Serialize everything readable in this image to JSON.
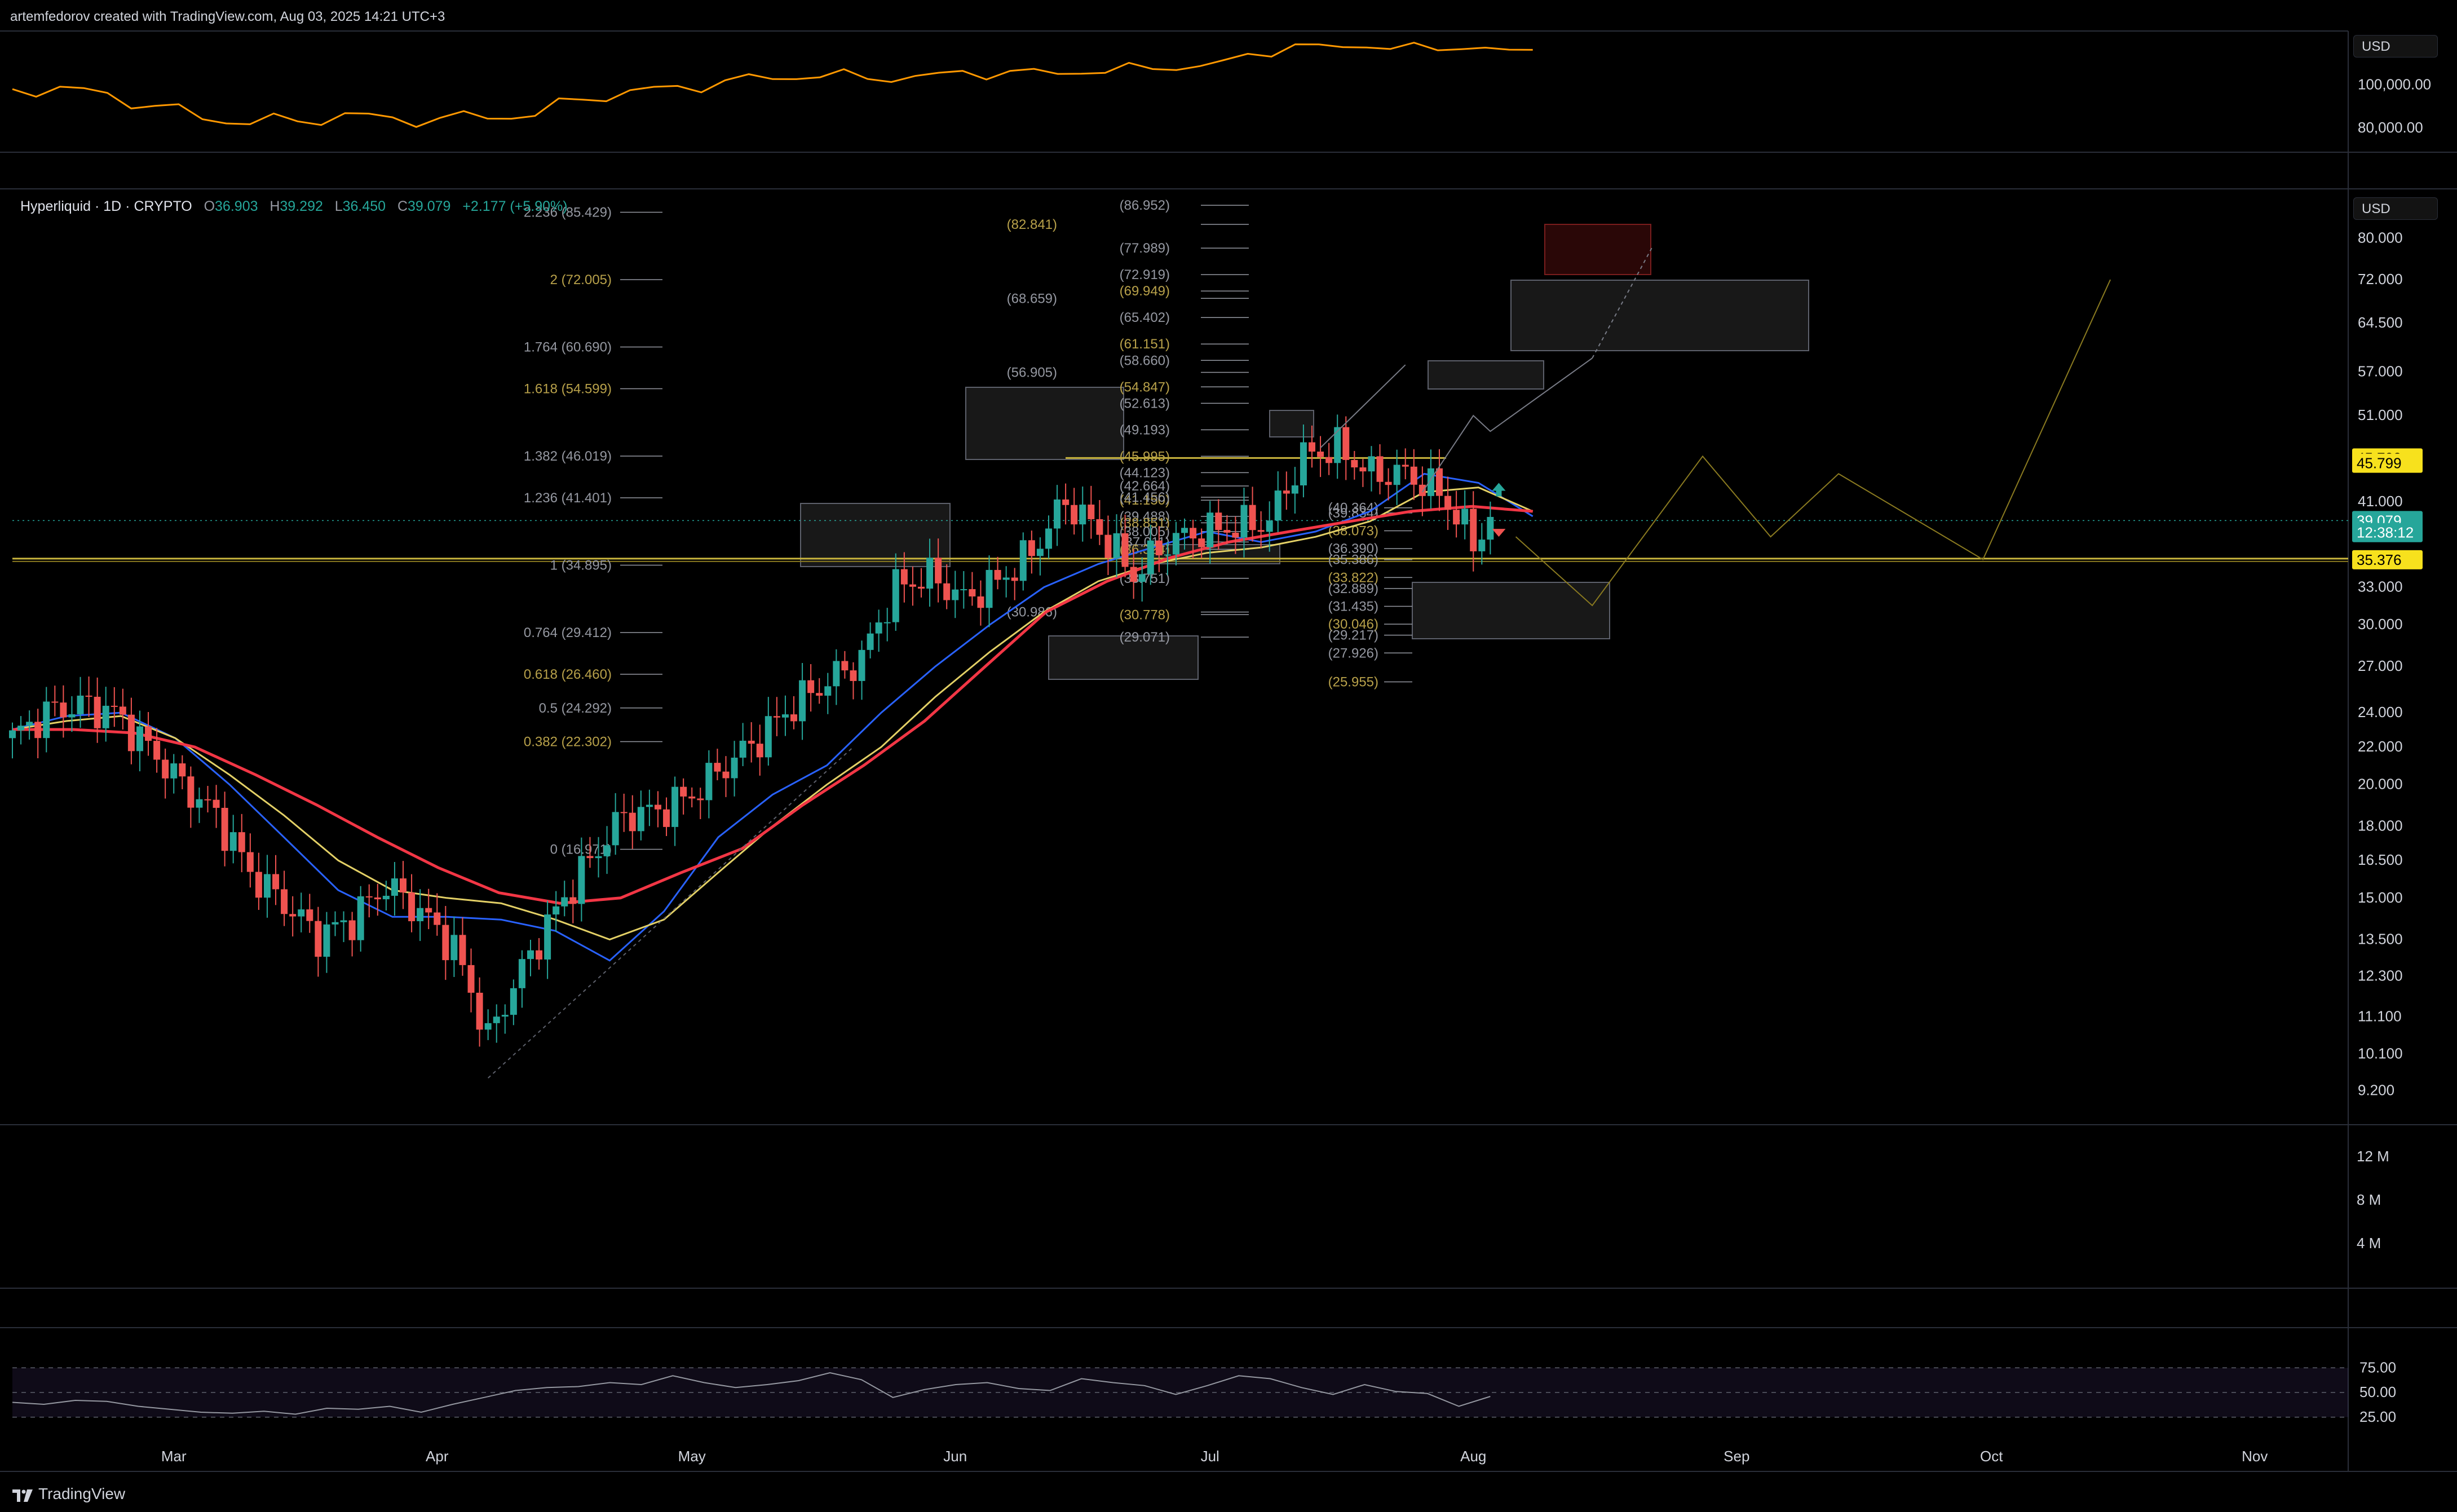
{
  "header": {
    "title": "artemfedorov created with TradingView.com, Aug 03, 2025 14:21 UTC+3",
    "brand": "TradingView"
  },
  "symbol": {
    "name": "Hyperliquid · 1D · CRYPTO",
    "o_label": "O",
    "o": "36.903",
    "h_label": "H",
    "h": "39.292",
    "l_label": "L",
    "l": "36.450",
    "c_label": "C",
    "c": "39.079",
    "change": "+2.177 (+5.90%)"
  },
  "currency": "USD",
  "colors": {
    "background": "#000000",
    "up": "#26a69a",
    "down": "#ef5350",
    "ema_blue": "#2962ff",
    "ema_yellow": "#e3d066",
    "ema_red": "#f23645",
    "btc_line": "#ff9800",
    "fib": "#9c8b3a",
    "rsi_band": "#7e57c2"
  },
  "chart_data": [
    {
      "type": "line",
      "pane": "top",
      "series": [
        {
          "values": [
            98000,
            97000,
            94000,
            90000,
            86000,
            84000,
            83500,
            85000,
            82500,
            84000,
            86000,
            88000,
            94000,
            96000,
            97000,
            101000,
            104000,
            106000,
            104000,
            103000,
            104000,
            105000,
            106000,
            108000,
            109000,
            108000,
            112000,
            117000,
            118000,
            119000,
            118000,
            117000,
            114000
          ]
        }
      ],
      "x_range": [
        "2025-02-10",
        "2025-08-03"
      ],
      "y_ticks": [
        "100,000.00",
        "80,000.00"
      ],
      "ylim": [
        70000,
        125000
      ]
    },
    {
      "type": "candlestick",
      "pane": "main",
      "scale": "log",
      "ylim": [
        8.5,
        90
      ],
      "y_ticks": [
        "80.000",
        "72.000",
        "64.500",
        "57.000",
        "51.000",
        "45.799",
        "41.000",
        "33.000",
        "30.000",
        "27.000",
        "24.000",
        "22.000",
        "20.000",
        "18.000",
        "16.500",
        "15.000",
        "13.500",
        "12.300",
        "11.100",
        "10.100",
        "9.200"
      ],
      "price_labels": [
        {
          "text": "45.799",
          "value": 45.799,
          "color": "#f7e11d"
        },
        {
          "text": "45.799",
          "value": 45.2,
          "color": "#f7e11d"
        },
        {
          "text": "39.079",
          "value": 39.079,
          "color": "#26a69a"
        },
        {
          "text": "12:38:12",
          "value": 37.9,
          "color": "#26a69a"
        },
        {
          "text": "35.376",
          "value": 35.376,
          "color": "#f7e11d"
        }
      ],
      "close_path": [
        [
          "2025-02-10",
          22.5
        ],
        [
          "2025-02-14",
          24
        ],
        [
          "2025-02-18",
          24.5
        ],
        [
          "2025-02-22",
          24
        ],
        [
          "2025-02-26",
          22
        ],
        [
          "2025-03-02",
          20
        ],
        [
          "2025-03-06",
          18.5
        ],
        [
          "2025-03-10",
          16
        ],
        [
          "2025-03-14",
          14.8
        ],
        [
          "2025-03-18",
          13.6
        ],
        [
          "2025-03-22",
          14.2
        ],
        [
          "2025-03-26",
          15.5
        ],
        [
          "2025-03-30",
          14.5
        ],
        [
          "2025-04-03",
          13.2
        ],
        [
          "2025-04-07",
          10.5
        ],
        [
          "2025-04-11",
          12.5
        ],
        [
          "2025-04-15",
          14.5
        ],
        [
          "2025-04-19",
          16.5
        ],
        [
          "2025-04-23",
          18.5
        ],
        [
          "2025-04-27",
          18.7
        ],
        [
          "2025-05-01",
          19.5
        ],
        [
          "2025-05-05",
          21
        ],
        [
          "2025-05-09",
          22.5
        ],
        [
          "2025-05-13",
          24.5
        ],
        [
          "2025-05-17",
          26
        ],
        [
          "2025-05-21",
          27.5
        ],
        [
          "2025-05-25",
          33
        ],
        [
          "2025-05-29",
          34
        ],
        [
          "2025-06-02",
          32
        ],
        [
          "2025-06-06",
          33.5
        ],
        [
          "2025-06-10",
          36
        ],
        [
          "2025-06-14",
          41
        ],
        [
          "2025-06-18",
          38
        ],
        [
          "2025-06-22",
          34
        ],
        [
          "2025-06-26",
          37
        ],
        [
          "2025-06-30",
          38
        ],
        [
          "2025-07-04",
          38.5
        ],
        [
          "2025-07-08",
          39
        ],
        [
          "2025-07-12",
          46
        ],
        [
          "2025-07-16",
          47
        ],
        [
          "2025-07-20",
          44
        ],
        [
          "2025-07-24",
          44
        ],
        [
          "2025-07-28",
          42
        ],
        [
          "2025-08-01",
          37
        ],
        [
          "2025-08-03",
          39.079
        ]
      ],
      "moving_averages": [
        {
          "name": "",
          "color": "#2962ff",
          "values": [
            23,
            23.8,
            24,
            22.5,
            20,
            17.5,
            15.3,
            14.3,
            14.3,
            14.2,
            13.8,
            12.8,
            14.5,
            17.5,
            19.5,
            21,
            24,
            27,
            30,
            33,
            35,
            36.5,
            38,
            37,
            38,
            40,
            44,
            43,
            39.5
          ]
        },
        {
          "name": "",
          "color": "#e3d066",
          "values": [
            23,
            23.5,
            23.8,
            22.5,
            20.5,
            18.5,
            16.5,
            15.3,
            15,
            14.8,
            14.2,
            13.5,
            14.2,
            16,
            18,
            20,
            22,
            25,
            28,
            31,
            33.5,
            35,
            36,
            36.5,
            37.5,
            39,
            42,
            42.5,
            40
          ]
        },
        {
          "name": "",
          "color": "#f23645",
          "values": [
            23,
            23,
            22.8,
            22,
            20.5,
            19,
            17.5,
            16.2,
            15.2,
            14.8,
            15,
            16,
            17,
            19,
            21,
            23.5,
            27,
            31,
            33.5,
            35.5,
            37,
            38,
            39,
            40,
            40.5,
            40
          ]
        }
      ],
      "fib_left": [
        "2.236 (85.429)",
        "2 (72.005)",
        "1.764 (60.690)",
        "1.618 (54.599)",
        "1.382 (46.019)",
        "1.236 (41.401)",
        "1 (34.895)",
        "0.764 (29.412)",
        "0.618 (26.460)",
        "0.5 (24.292)",
        "0.382 (22.302)",
        "0 (16.971)"
      ],
      "fib_mid": [
        "(86.952)",
        "(82.841)",
        "(77.989)",
        "(72.919)",
        "(69.949)",
        "(68.659)",
        "(65.402)",
        "(61.151)",
        "(58.660)",
        "(56.905)",
        "(54.847)",
        "(52.613)",
        "(49.193)",
        "(45.995)",
        "(44.123)",
        "(42.664)",
        "(41.150)",
        "(41.456)",
        "(39.488)",
        "(38.851)",
        "(38.005)",
        "(37.011)",
        "(36.324)",
        "(33.751)",
        "(30.986)",
        "(30.778)",
        "(29.071)"
      ],
      "fib_right": [
        "(40.364)",
        "(39.834)",
        "(38.073)",
        "(36.390)",
        "(35.386)",
        "(33.822)",
        "(32.889)",
        "(31.435)",
        "(30.046)",
        "(29.217)",
        "(27.926)",
        "(25.955)"
      ]
    },
    {
      "type": "bar",
      "pane": "volume",
      "y_ticks": [
        "12 M",
        "8 M",
        "4 M"
      ]
    },
    {
      "type": "line",
      "pane": "rsi",
      "y_ticks": [
        "75.00",
        "50.00",
        "25.00"
      ],
      "series": [
        {
          "values": [
            40,
            38,
            42,
            41,
            36,
            33,
            30,
            29,
            31,
            28,
            34,
            33,
            36,
            30,
            38,
            45,
            52,
            55,
            56,
            60,
            58,
            67,
            60,
            55,
            58,
            62,
            70,
            63,
            45,
            53,
            58,
            60,
            54,
            52,
            64,
            60,
            57,
            48,
            57,
            67,
            64,
            55,
            48,
            58,
            51,
            49,
            36,
            46
          ]
        }
      ],
      "ylim": [
        0,
        100
      ]
    }
  ],
  "x_axis": {
    "labels": [
      "Mar",
      "Apr",
      "May",
      "Jun",
      "Jul",
      "Aug",
      "Sep",
      "Oct",
      "Nov"
    ]
  }
}
